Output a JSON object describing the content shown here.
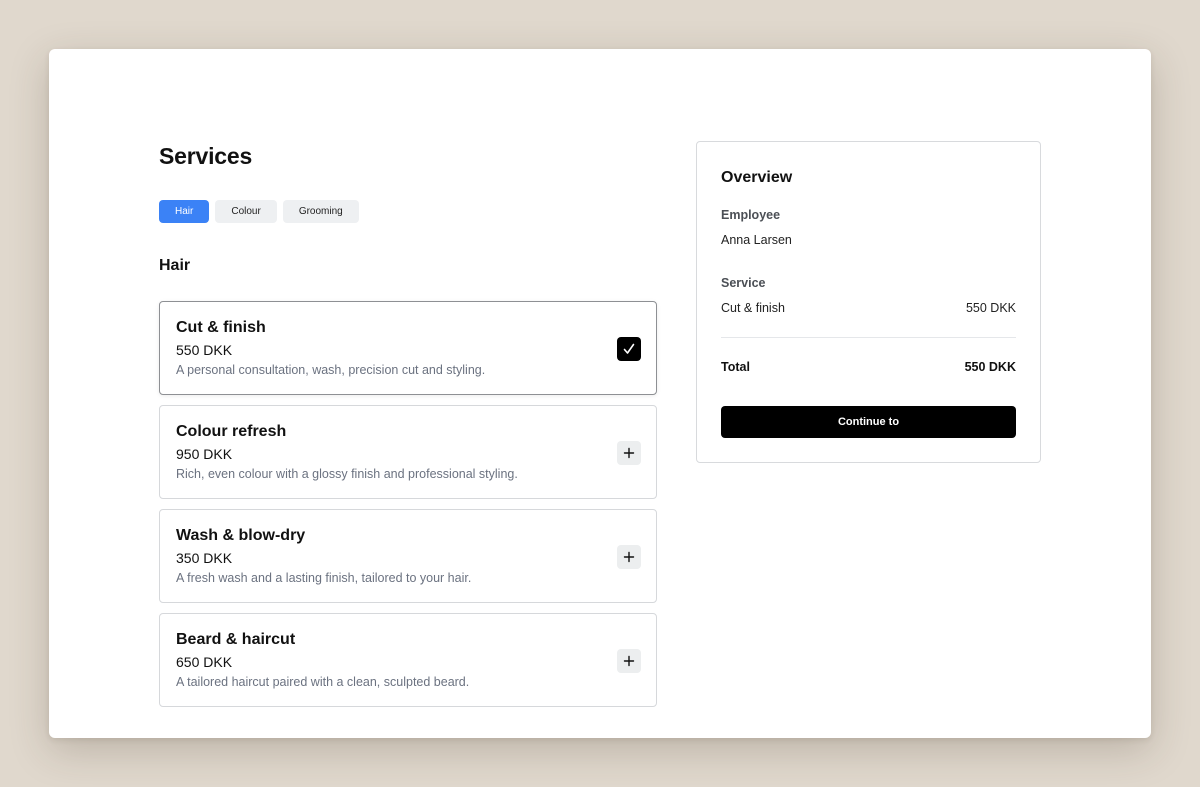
{
  "page": {
    "title": "Services"
  },
  "tabs": [
    {
      "label": "Hair",
      "active": true
    },
    {
      "label": "Colour",
      "active": false
    },
    {
      "label": "Grooming",
      "active": false
    }
  ],
  "section": {
    "title": "Hair"
  },
  "services": [
    {
      "name": "Cut & finish",
      "price": "550 DKK",
      "description": "A personal consultation, wash, precision cut and styling.",
      "selected": true,
      "action_icon": "checkmark-icon"
    },
    {
      "name": "Colour refresh",
      "price": "950 DKK",
      "description": "Rich, even colour with a glossy finish and professional styling.",
      "selected": false,
      "action_icon": "plus-icon"
    },
    {
      "name": "Wash & blow-dry",
      "price": "350 DKK",
      "description": "A fresh wash and a lasting finish, tailored to your hair.",
      "selected": false,
      "action_icon": "plus-icon"
    },
    {
      "name": "Beard & haircut",
      "price": "650 DKK",
      "description": "A tailored haircut paired with a clean, sculpted beard.",
      "selected": false,
      "action_icon": "plus-icon"
    }
  ],
  "overview": {
    "title": "Overview",
    "employee_label": "Employee",
    "employee_value": "Anna Larsen",
    "service_label": "Service",
    "service_name": "Cut & finish",
    "service_price": "550 DKK",
    "total_label": "Total",
    "total_value": "550 DKK",
    "cta_label": "Continue to"
  },
  "colors": {
    "accent": "#3b82f6",
    "background": "#e0d8cd",
    "cta": "#000000",
    "muted_text": "#6b7280"
  }
}
